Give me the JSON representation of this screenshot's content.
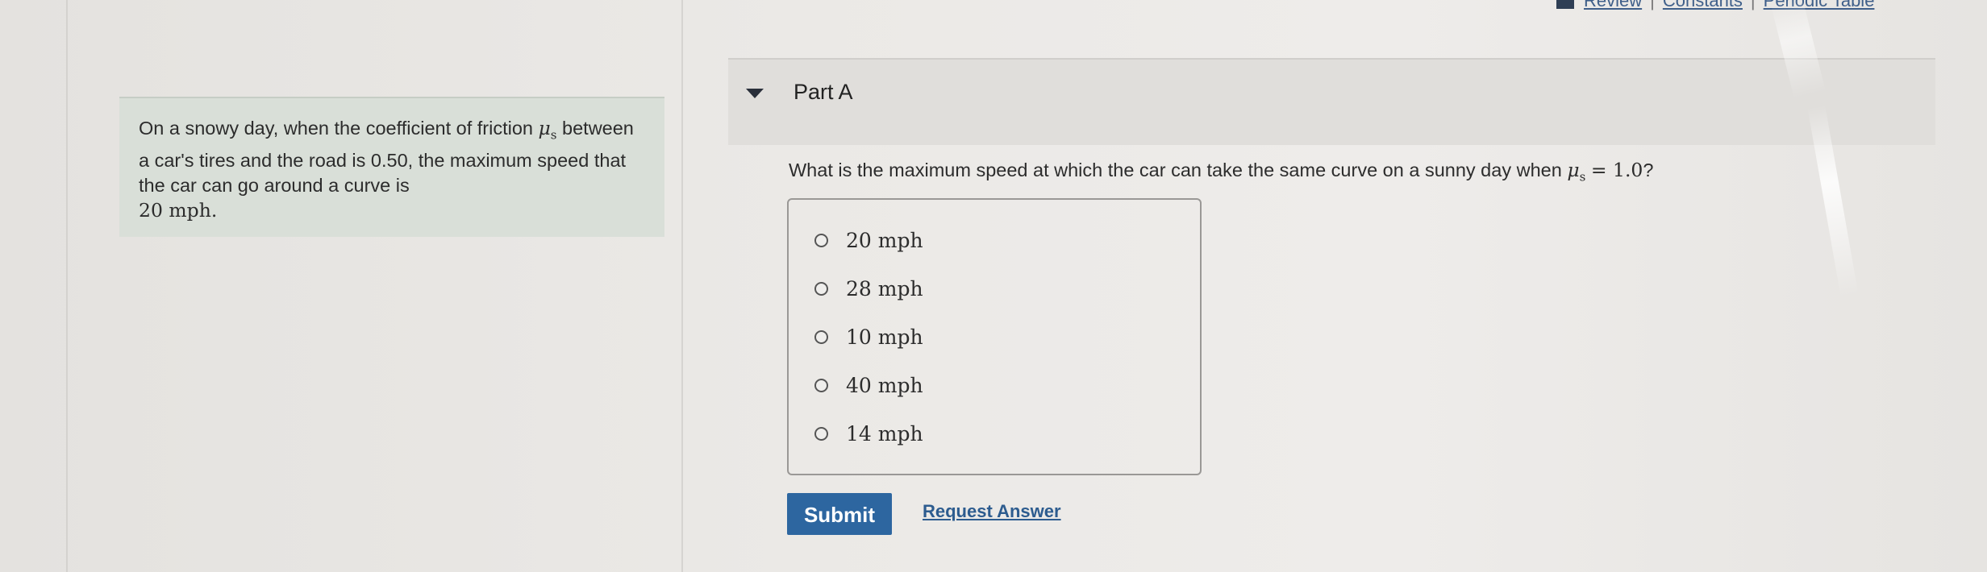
{
  "top_links": {
    "review": "Review",
    "constants": "Constants",
    "periodic_table": "Periodic Table",
    "separator": "|"
  },
  "problem": {
    "text_part1": "On a snowy day, when the coefficient of friction",
    "mu_symbol": "μ",
    "mu_subscript": "s",
    "text_part2": "between a car's tires and the road is 0.50, the maximum speed that the car can go around a curve is",
    "speed_value": "20 mph."
  },
  "part": {
    "title": "Part A"
  },
  "question": {
    "text_before": "What is the maximum speed at which the car can take the sa",
    "text_cursor_char": "m",
    "text_middle": "e curve on a sunny day when",
    "mu_symbol": "μ",
    "mu_subscript": "s",
    "equals_value": "= 1.0",
    "end": "?"
  },
  "choices": [
    {
      "label": "20 mph"
    },
    {
      "label": "28 mph"
    },
    {
      "label": "10 mph"
    },
    {
      "label": "40 mph"
    },
    {
      "label": "14 mph"
    }
  ],
  "actions": {
    "submit_label": "Submit",
    "request_answer_label": "Request Answer"
  },
  "colors": {
    "submit_bg": "#2d66a0",
    "problem_bg": "#d9dfd8",
    "link": "#2d5c8f"
  }
}
